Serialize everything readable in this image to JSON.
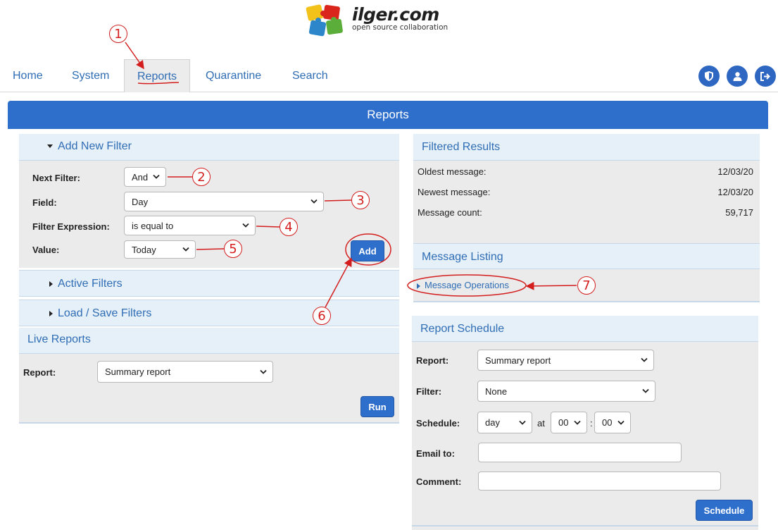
{
  "logo": {
    "name": "ilger.com",
    "tagline": "open source collaboration"
  },
  "nav": {
    "tabs": [
      {
        "label": "Home",
        "active": false
      },
      {
        "label": "System",
        "active": false
      },
      {
        "label": "Reports",
        "active": true
      },
      {
        "label": "Quarantine",
        "active": false
      },
      {
        "label": "Search",
        "active": false
      }
    ],
    "icons": [
      "shield-icon",
      "user-icon",
      "logout-icon"
    ]
  },
  "page_title": "Reports",
  "add_filter": {
    "heading": "Add New Filter",
    "next_filter_label": "Next Filter:",
    "next_filter_value": "And",
    "field_label": "Field:",
    "field_value": "Day",
    "expression_label": "Filter Expression:",
    "expression_value": "is equal to",
    "value_label": "Value:",
    "value_value": "Today",
    "add_button": "Add"
  },
  "active_filters": {
    "heading": "Active Filters"
  },
  "load_save": {
    "heading": "Load / Save Filters"
  },
  "live_reports": {
    "heading": "Live Reports",
    "report_label": "Report:",
    "report_value": "Summary report",
    "run_button": "Run"
  },
  "filtered_results": {
    "heading": "Filtered Results",
    "rows": [
      {
        "label": "Oldest message:",
        "value": "12/03/20"
      },
      {
        "label": "Newest message:",
        "value": "12/03/20"
      },
      {
        "label": "Message count:",
        "value": "59,717"
      }
    ]
  },
  "message_listing": {
    "heading": "Message Listing",
    "operations_link": "Message Operations"
  },
  "report_schedule": {
    "heading": "Report Schedule",
    "report_label": "Report:",
    "report_value": "Summary report",
    "filter_label": "Filter:",
    "filter_value": "None",
    "schedule_label": "Schedule:",
    "schedule_period": "day",
    "at_label": "at",
    "hour": "00",
    "colon": ":",
    "minute": "00",
    "email_label": "Email to:",
    "email_value": "",
    "comment_label": "Comment:",
    "comment_value": "",
    "schedule_button": "Schedule"
  },
  "annotations": [
    "1",
    "2",
    "3",
    "4",
    "5",
    "6",
    "7"
  ],
  "colors": {
    "accent": "#2e6fcb",
    "link": "#2f6db5",
    "panel_head": "#e6f0f8",
    "annotation": "#d41e1e"
  }
}
